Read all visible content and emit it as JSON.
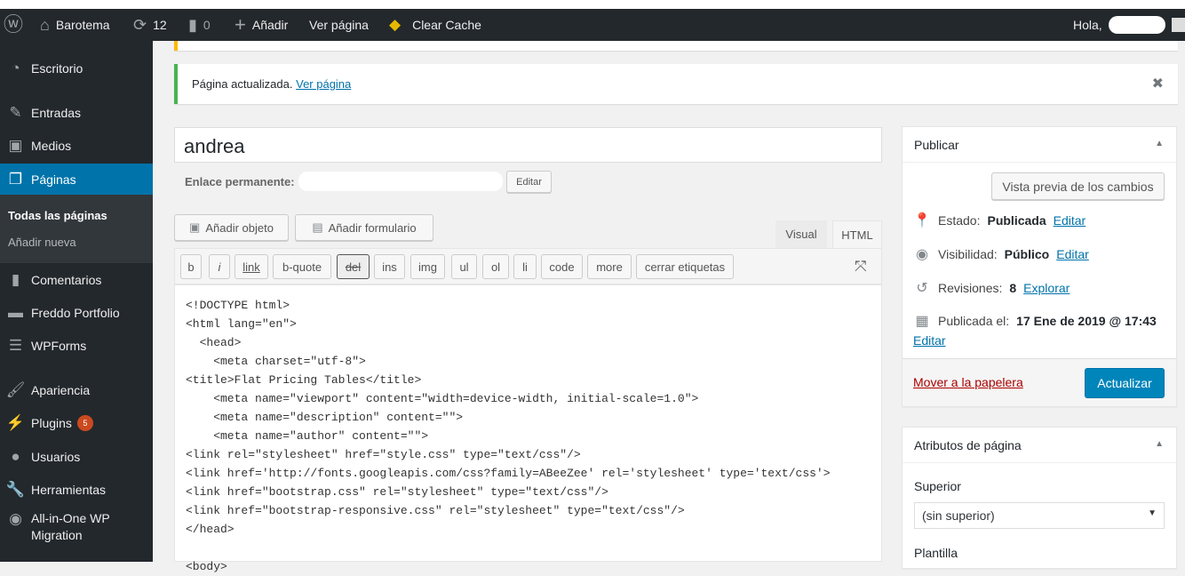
{
  "adminbar": {
    "site": "Barotema",
    "updates": "12",
    "comments": "0",
    "add": "Añadir",
    "view": "Ver página",
    "cache": "Clear Cache",
    "greeting": "Hola,"
  },
  "sidebar": {
    "items": [
      {
        "label": "Escritorio",
        "icon": "dashboard-icon"
      },
      {
        "label": "Entradas",
        "icon": "pin-icon"
      },
      {
        "label": "Medios",
        "icon": "media-icon"
      },
      {
        "label": "Páginas",
        "icon": "pages-icon"
      },
      {
        "label": "Comentarios",
        "icon": "comment-icon"
      },
      {
        "label": "Freddo Portfolio",
        "icon": "folder-icon"
      },
      {
        "label": "WPForms",
        "icon": "form-icon"
      },
      {
        "label": "Apariencia",
        "icon": "brush-icon"
      },
      {
        "label": "Plugins",
        "icon": "plugin-icon",
        "badge": "5"
      },
      {
        "label": "Usuarios",
        "icon": "user-icon"
      },
      {
        "label": "Herramientas",
        "icon": "wrench-icon"
      },
      {
        "label": "All-in-One WP Migration",
        "icon": "migration-icon"
      }
    ],
    "submenu": [
      "Todas las páginas",
      "Añadir nueva"
    ]
  },
  "notice": {
    "text": "Página actualizada.",
    "link": "Ver página"
  },
  "editor": {
    "title": "andrea",
    "permalink_label": "Enlace permanente:",
    "edit": "Editar",
    "add_media": "Añadir objeto",
    "add_form": "Añadir formulario",
    "tab_visual": "Visual",
    "tab_html": "HTML",
    "quicktags": [
      "b",
      "i",
      "link",
      "b-quote",
      "del",
      "ins",
      "img",
      "ul",
      "ol",
      "li",
      "code",
      "more",
      "cerrar etiquetas"
    ],
    "code": "<!DOCTYPE html>\n<html lang=\"en\">\n  <head>\n    <meta charset=\"utf-8\">\n<title>Flat Pricing Tables</title>\n    <meta name=\"viewport\" content=\"width=device-width, initial-scale=1.0\">\n    <meta name=\"description\" content=\"\">\n    <meta name=\"author\" content=\"\">\n<link rel=\"stylesheet\" href=\"style.css\" type=\"text/css\"/>\n<link href='http://fonts.googleapis.com/css?family=ABeeZee' rel='stylesheet' type='text/css'>\n<link href=\"bootstrap.css\" rel=\"stylesheet\" type=\"text/css\"/>\n<link href=\"bootstrap-responsive.css\" rel=\"stylesheet\" type=\"text/css\"/>\n</head>\n\n<body>"
  },
  "publish": {
    "title": "Publicar",
    "preview": "Vista previa de los cambios",
    "status_label": "Estado:",
    "status": "Publicada",
    "visibility_label": "Visibilidad:",
    "visibility": "Público",
    "revisions_label": "Revisiones:",
    "revisions": "8",
    "explore": "Explorar",
    "published_label": "Publicada el:",
    "published": "17 Ene de 2019 @ 17:43",
    "edit": "Editar",
    "trash": "Mover a la papelera",
    "update": "Actualizar"
  },
  "attributes": {
    "title": "Atributos de página",
    "parent_label": "Superior",
    "parent_value": "(sin superior)",
    "template_label": "Plantilla"
  },
  "colors": {
    "accent": "#0073aa",
    "adminbar": "#23282d",
    "success": "#46b450",
    "warning": "#ffb900",
    "trash": "#a00"
  }
}
